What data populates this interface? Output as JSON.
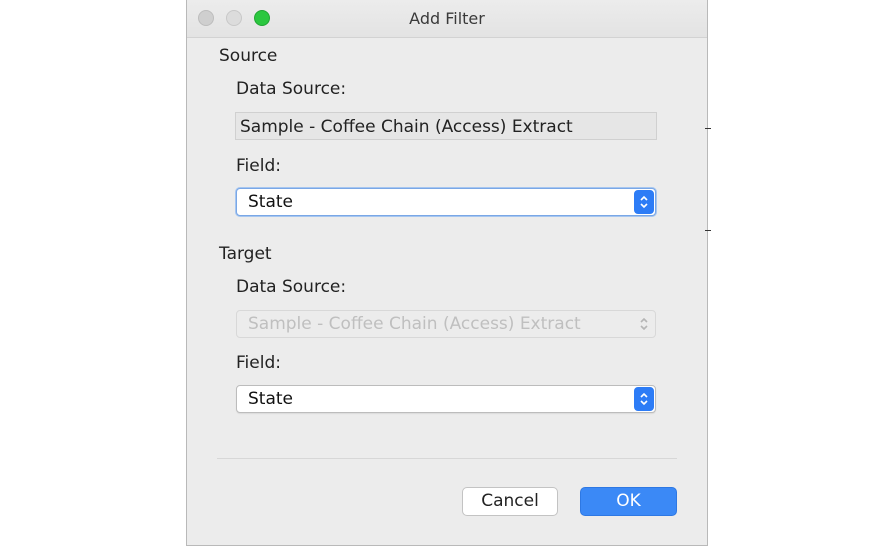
{
  "window": {
    "title": "Add Filter"
  },
  "source": {
    "heading": "Source",
    "data_source_label": "Data Source:",
    "data_source_value": "Sample - Coffee Chain (Access) Extract",
    "field_label": "Field:",
    "field_value": "State"
  },
  "target": {
    "heading": "Target",
    "data_source_label": "Data Source:",
    "data_source_value": "Sample - Coffee Chain (Access) Extract",
    "field_label": "Field:",
    "field_value": "State"
  },
  "buttons": {
    "cancel_label": "Cancel",
    "ok_label": "OK"
  },
  "colors": {
    "accent": "#3b89f6",
    "zoom_button": "#2bc73f"
  }
}
